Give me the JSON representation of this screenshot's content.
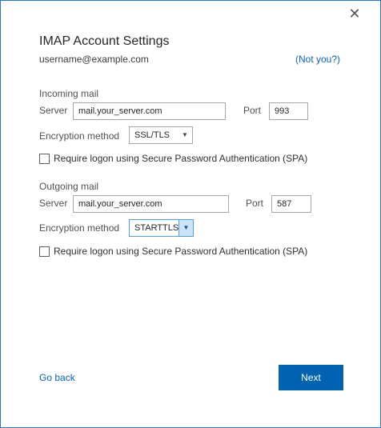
{
  "dialog": {
    "close_glyph": "✕",
    "title": "IMAP Account Settings",
    "email": "username@example.com",
    "not_you": "(Not you?)"
  },
  "incoming": {
    "section_label": "Incoming mail",
    "server_label": "Server",
    "server_value": "mail.your_server.com",
    "port_label": "Port",
    "port_value": "993",
    "encryption_label": "Encryption method",
    "encryption_value": "SSL/TLS",
    "spa_label": "Require logon using Secure Password Authentication (SPA)",
    "spa_checked": false
  },
  "outgoing": {
    "section_label": "Outgoing mail",
    "server_label": "Server",
    "server_value": "mail.your_server.com",
    "port_label": "Port",
    "port_value": "587",
    "encryption_label": "Encryption method",
    "encryption_value": "STARTTLS",
    "spa_label": "Require logon using Secure Password Authentication (SPA)",
    "spa_checked": false
  },
  "footer": {
    "go_back": "Go back",
    "next": "Next"
  },
  "icons": {
    "close": "close-icon",
    "dropdown": "chevron-down-icon"
  },
  "colors": {
    "accent": "#0063b1",
    "link": "#0563c1",
    "border": "#2b79d0"
  }
}
